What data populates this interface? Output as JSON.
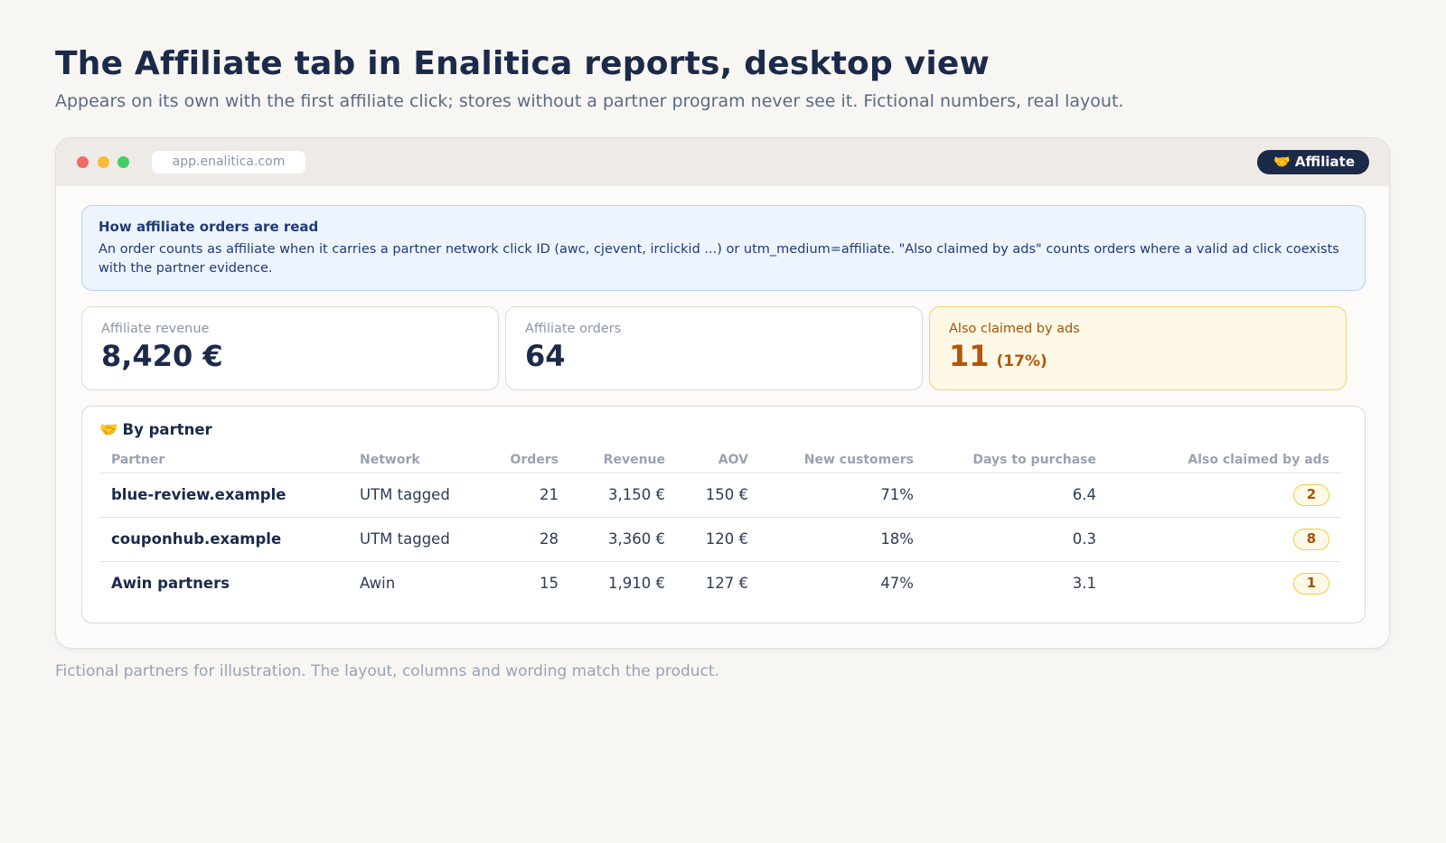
{
  "page": {
    "title": "The Affiliate tab in Enalitica reports, desktop view",
    "subtitle": "Appears on its own with the first affiliate click; stores without a partner program never see it. Fictional numbers, real layout.",
    "footnote": "Fictional partners for illustration. The layout, columns and wording match the product."
  },
  "window": {
    "url": "app.enalitica.com",
    "tab": {
      "emoji": "🤝",
      "label": "Affiliate"
    }
  },
  "info": {
    "title": "How affiliate orders are read",
    "text": "An order counts as affiliate when it carries a partner network click ID (awc, cjevent, irclickid ...) or utm_medium=affiliate. \"Also claimed by ads\" counts orders where a valid ad click coexists with the partner evidence."
  },
  "kpis": [
    {
      "label": "Affiliate revenue",
      "value": "8,420 €"
    },
    {
      "label": "Affiliate orders",
      "value": "64"
    },
    {
      "label": "Also claimed by ads",
      "value": "11",
      "pct": "(17%)"
    }
  ],
  "partners_table": {
    "emoji": "🤝",
    "title": "By partner",
    "columns": [
      "Partner",
      "Network",
      "Orders",
      "Revenue",
      "AOV",
      "New customers",
      "Days to purchase",
      "Also claimed by ads"
    ],
    "rows": [
      {
        "partner": "blue-review.example",
        "network": "UTM tagged",
        "orders": "21",
        "revenue": "3,150 €",
        "aov": "150 €",
        "new_customers": "71%",
        "days": "6.4",
        "claimed": "2"
      },
      {
        "partner": "couponhub.example",
        "network": "UTM tagged",
        "orders": "28",
        "revenue": "3,360 €",
        "aov": "120 €",
        "new_customers": "18%",
        "days": "0.3",
        "claimed": "8"
      },
      {
        "partner": "Awin partners",
        "network": "Awin",
        "orders": "15",
        "revenue": "1,910 €",
        "aov": "127 €",
        "new_customers": "47%",
        "days": "3.1",
        "claimed": "1"
      }
    ]
  }
}
